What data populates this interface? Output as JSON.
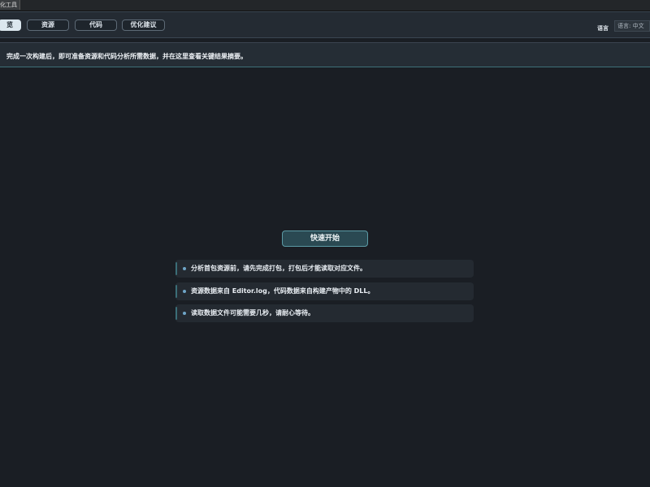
{
  "window": {
    "title": "化工具"
  },
  "tabs": [
    {
      "label": "览"
    },
    {
      "label": "资源"
    },
    {
      "label": "代码"
    },
    {
      "label": "优化建议"
    }
  ],
  "language": {
    "label": "语言",
    "value": "语言: 中文"
  },
  "notice": "完成一次构建后，即可准备资源和代码分析所需数据，并在这里查看关键结果摘要。",
  "quickstart": {
    "button_label": "快速开始",
    "tips": [
      "分析首包资源前，请先完成打包，打包后才能读取对应文件。",
      "资源数据来自 Editor.log，代码数据来自构建产物中的 DLL。",
      "读取数据文件可能需要几秒，请耐心等待。"
    ]
  },
  "colors": {
    "background": "#1a1e24",
    "active_tab": "#dbe7ee",
    "accent": "#5b9aa5",
    "bullet": "#6fa6c8"
  }
}
